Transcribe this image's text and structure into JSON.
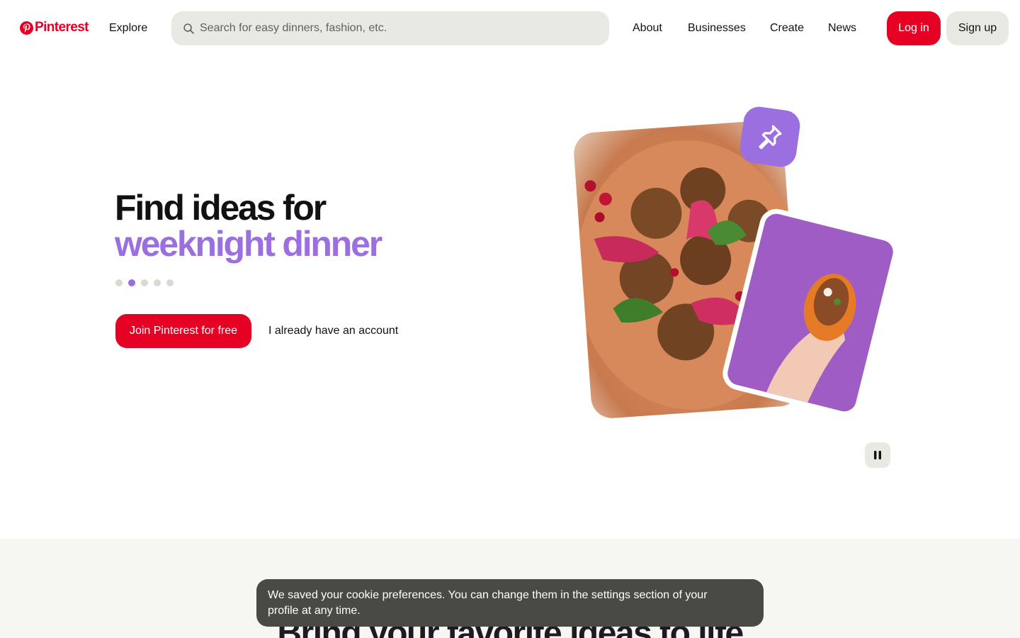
{
  "header": {
    "logo_text": "Pinterest",
    "explore_label": "Explore",
    "search_placeholder": "Search for easy dinners, fashion, etc.",
    "nav": [
      "About",
      "Businesses",
      "Create",
      "News"
    ],
    "login_label": "Log in",
    "signup_label": "Sign up"
  },
  "hero": {
    "title_line1": "Find ideas for",
    "title_line2": "weeknight dinner",
    "carousel_count": 5,
    "carousel_active": 2,
    "join_label": "Join Pinterest for free",
    "account_label": "I already have an account"
  },
  "section": {
    "heading": "Bring your favorite ideas to life"
  },
  "toast": {
    "message": "We saved your cookie preferences. You can change them in the settings section of your profile at any time."
  },
  "colors": {
    "brand_red": "#e60023",
    "accent_purple": "#9b6fe0",
    "button_grey": "#e9e9e4",
    "toast_bg": "#4a4a45"
  },
  "icons": {
    "logo": "pinterest-logo-icon",
    "search": "search-icon",
    "pin": "pushpin-icon",
    "pause": "pause-icon"
  }
}
